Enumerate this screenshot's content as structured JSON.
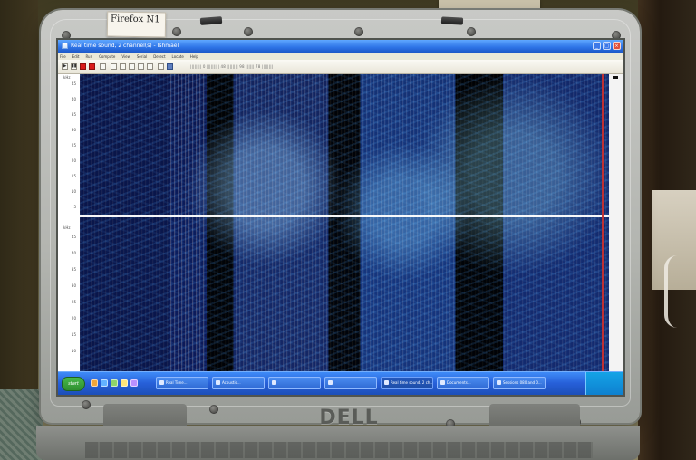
{
  "photo": {
    "sticker_text": "Firefox N1",
    "brand_logo": "DELL"
  },
  "window": {
    "title": "Real time sound, 2 channel(s) - Ishmael",
    "menu_items": [
      "File",
      "Edit",
      "Run",
      "Compute",
      "View",
      "Serial",
      "Detect",
      "Locate",
      "Help"
    ],
    "toolbar_info": "|||||||| 0 ||||||||| 48 |||||||| 98 |||||| 78 ||||||||"
  },
  "spectrogram": {
    "top_channel": {
      "unit": "kHz",
      "labels": [
        "45",
        "40",
        "35",
        "30",
        "25",
        "20",
        "15",
        "10",
        "5"
      ]
    },
    "bottom_channel": {
      "unit": "kHz",
      "labels": [
        "45",
        "40",
        "35",
        "30",
        "25",
        "20",
        "15",
        "10"
      ]
    }
  },
  "taskbar": {
    "start_label": "start",
    "items": [
      "Real Time...",
      "Acoustic...",
      "",
      "",
      "Real time sound, 2 ch...",
      "Documents...",
      "Sessions 080 and 0..."
    ],
    "time": ""
  }
}
